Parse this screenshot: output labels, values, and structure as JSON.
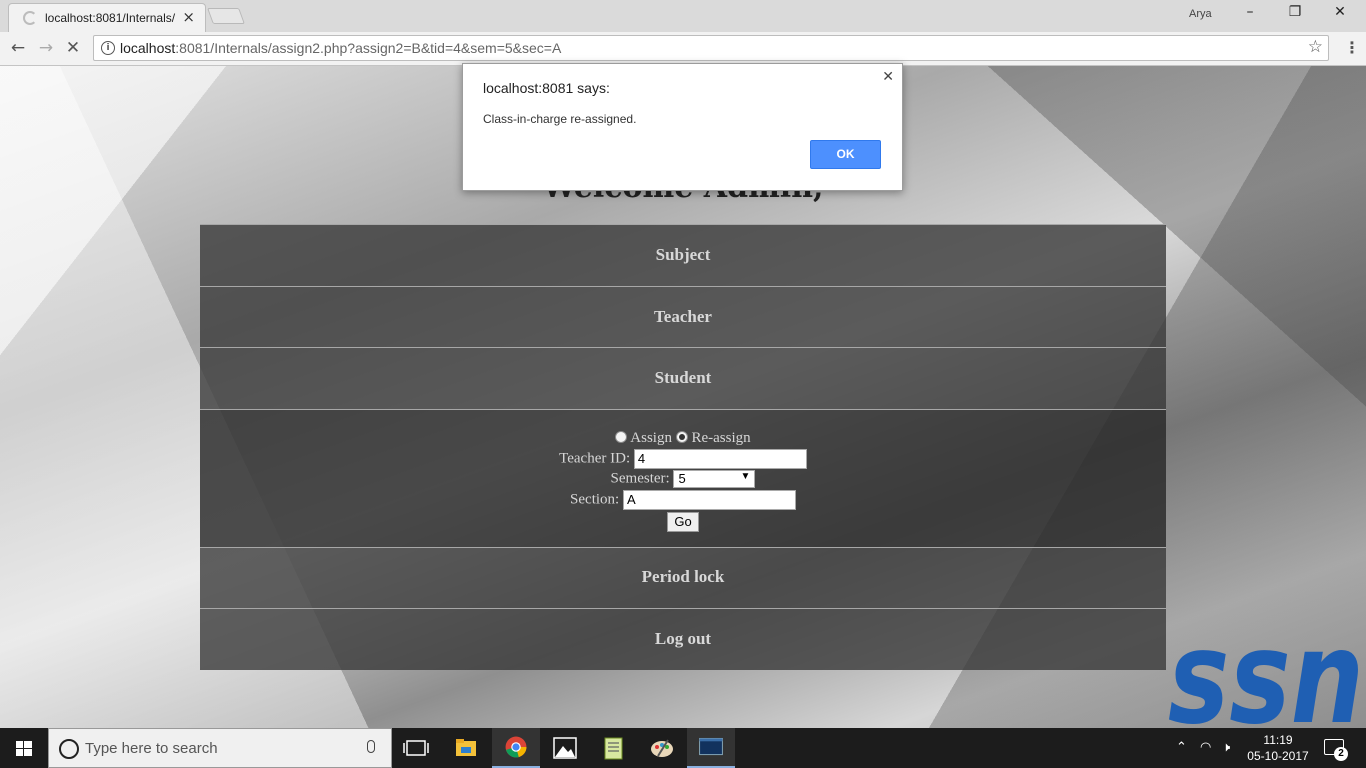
{
  "browser": {
    "tab_title": "localhost:8081/Internals/",
    "profile_name": "Arya",
    "url_host": "localhost",
    "url_rest": ":8081/Internals/assign2.php?assign2=B&tid=4&sem=5&sec=A"
  },
  "page": {
    "heading": "Welcome Admin,",
    "menu": {
      "subject": "Subject",
      "teacher": "Teacher",
      "student": "Student",
      "period_lock": "Period lock",
      "logout": "Log out"
    },
    "form": {
      "radio_assign_label": "Assign",
      "radio_reassign_label": "Re-assign",
      "selected_mode": "Re-assign",
      "teacher_id_label": "Teacher ID:",
      "teacher_id_value": "4",
      "semester_label": "Semester:",
      "semester_value": "5",
      "section_label": "Section:",
      "section_value": "A",
      "go_label": "Go"
    },
    "logo_text": "ssn",
    "logo_color": "#1f5fb3"
  },
  "dialog": {
    "title": "localhost:8081 says:",
    "message": "Class-in-charge re-assigned.",
    "ok_label": "OK",
    "accent": "#4d90fe"
  },
  "taskbar": {
    "search_placeholder": "Type here to search",
    "time": "11:19",
    "date": "05-10-2017",
    "notification_count": "2",
    "pinned_apps": [
      "task-view-icon",
      "file-explorer-icon",
      "chrome-icon",
      "photos-icon",
      "notepad-icon",
      "paint-icon",
      "mysql-icon"
    ]
  }
}
